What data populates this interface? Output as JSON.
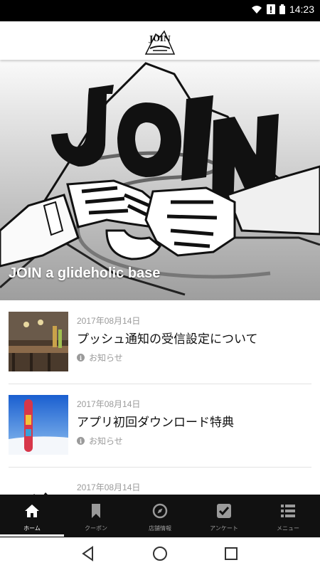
{
  "statusbar": {
    "time": "14:23",
    "icons": [
      "wifi-icon",
      "alert-icon",
      "battery-icon"
    ]
  },
  "header": {
    "logo_text": "JOIN"
  },
  "hero": {
    "title": "JOIN a glideholic base"
  },
  "news": [
    {
      "date": "2017年08月14日",
      "title": "プッシュ通知の受信設定について",
      "category": "お知らせ"
    },
    {
      "date": "2017年08月14日",
      "title": "アプリ初回ダウンロード特典",
      "category": "お知らせ"
    },
    {
      "date": "2017年08月14日"
    }
  ],
  "tabs": [
    {
      "label": "ホーム",
      "icon": "home-icon",
      "active": true
    },
    {
      "label": "クーポン",
      "icon": "bookmark-icon",
      "active": false
    },
    {
      "label": "店舗情報",
      "icon": "compass-icon",
      "active": false
    },
    {
      "label": "アンケート",
      "icon": "checkbox-icon",
      "active": false
    },
    {
      "label": "メニュー",
      "icon": "menu-list-icon",
      "active": false
    }
  ],
  "colors": {
    "tabbar_bg": "#111111",
    "statusbar_bg": "#000000",
    "text_gray": "#9a9a9a"
  }
}
